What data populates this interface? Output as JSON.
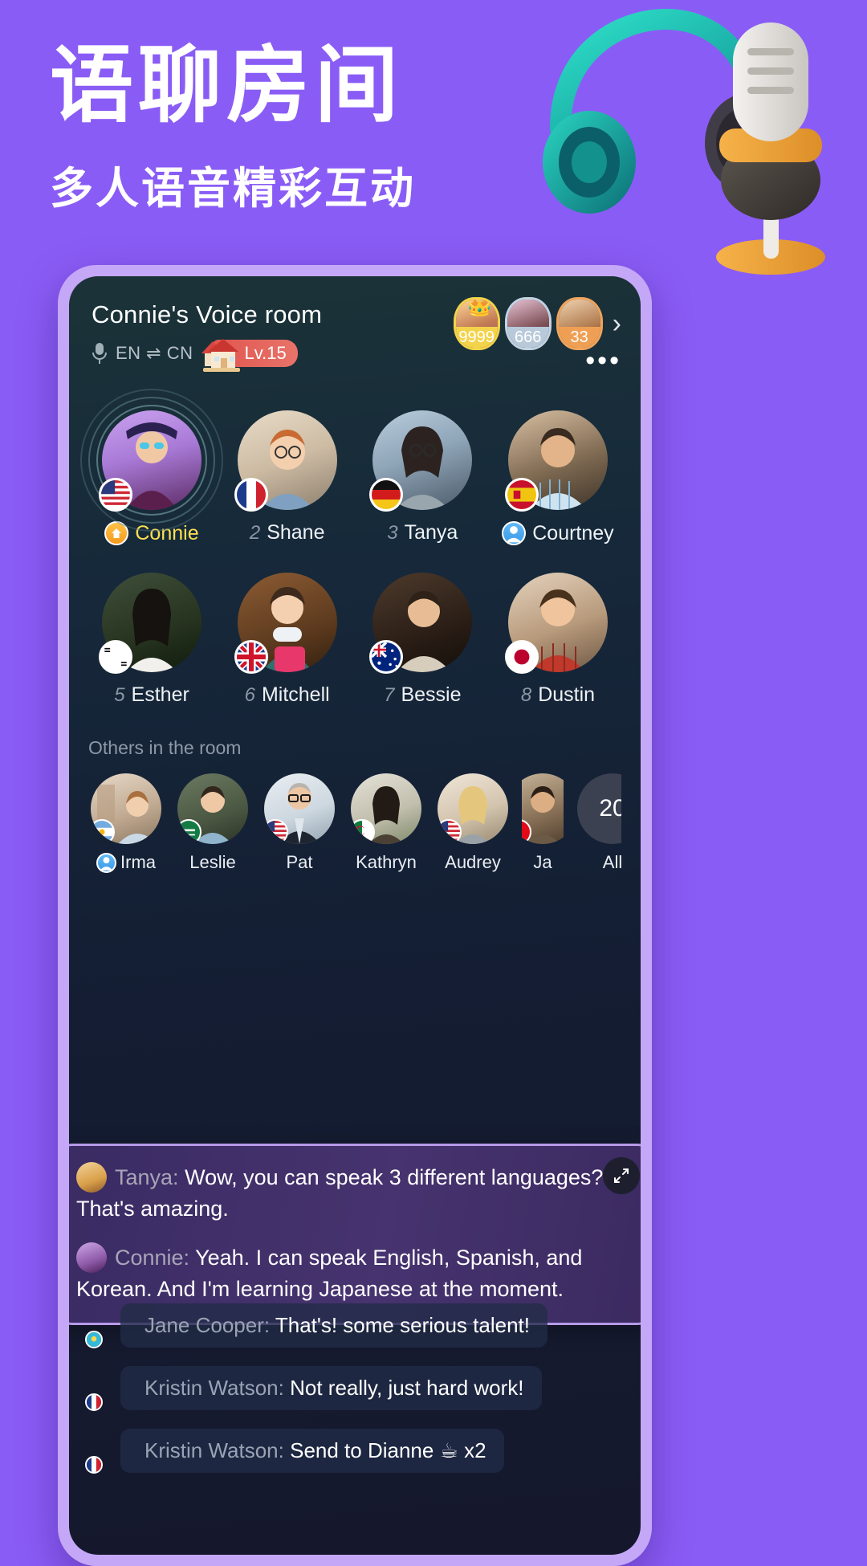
{
  "hero": {
    "title": "语聊房间",
    "subtitle": "多人语音精彩互动",
    "bg_color": "#8a5cf6",
    "art": [
      "headphones-illustration",
      "microphone-illustration"
    ]
  },
  "room": {
    "title": "Connie's Voice room",
    "mic_icon": "microphone-icon",
    "language": "EN ⇌ CN",
    "level_badge": {
      "label": "Lv.15",
      "icon": "house-icon"
    },
    "more_icon": "more-dots-icon",
    "chevron_icon": "chevron-right-icon",
    "rank_badges": [
      {
        "value": "9999",
        "accent": "#f3d34a",
        "crown": "crown-icon"
      },
      {
        "value": "666",
        "accent": "#b8c9da",
        "crown": ""
      },
      {
        "value": "33",
        "accent": "#ef9f54",
        "crown": ""
      }
    ]
  },
  "seats": {
    "row1": [
      {
        "num": "",
        "name": "Connie",
        "flag": "us-flag",
        "badge": "home-badge",
        "host": true,
        "speaking": true
      },
      {
        "num": "2",
        "name": "Shane",
        "flag": "fr-flag",
        "badge": "",
        "host": false,
        "speaking": false
      },
      {
        "num": "3",
        "name": "Tanya",
        "flag": "de-flag",
        "badge": "",
        "host": false,
        "speaking": false
      },
      {
        "num": "",
        "name": "Courtney",
        "flag": "es-flag",
        "badge": "user-badge",
        "host": false,
        "speaking": false
      }
    ],
    "row2": [
      {
        "num": "5",
        "name": "Esther",
        "flag": "kr-flag",
        "badge": "",
        "host": false,
        "speaking": false
      },
      {
        "num": "6",
        "name": "Mitchell",
        "flag": "gb-flag",
        "badge": "",
        "host": false,
        "speaking": false
      },
      {
        "num": "7",
        "name": "Bessie",
        "flag": "au-flag",
        "badge": "",
        "host": false,
        "speaking": false
      },
      {
        "num": "8",
        "name": "Dustin",
        "flag": "jp-flag",
        "badge": "",
        "host": false,
        "speaking": false
      }
    ]
  },
  "others": {
    "title": "Others in the room",
    "people": [
      {
        "name": "Irma",
        "flag": "ar-flag",
        "badge": "user-badge"
      },
      {
        "name": "Leslie",
        "flag": "sa-flag",
        "badge": ""
      },
      {
        "name": "Pat",
        "flag": "us-flag",
        "badge": ""
      },
      {
        "name": "Kathryn",
        "flag": "dz-flag",
        "badge": ""
      },
      {
        "name": "Audrey",
        "flag": "us-flag",
        "badge": ""
      },
      {
        "name": "Ja",
        "flag": "tr-flag",
        "badge": ""
      }
    ],
    "all_count": "20",
    "all_label": "All"
  },
  "highlight": {
    "expand_icon": "expand-icon",
    "messages": [
      {
        "speaker": "Tanya:",
        "text": "Wow, you can speak 3 different languages? That's amazing."
      },
      {
        "speaker": "Connie:",
        "text": "Yeah. I can speak English, Spanish, and Korean. And I'm learning Japanese at the moment."
      }
    ]
  },
  "chat": {
    "messages": [
      {
        "speaker": "Jane Cooper:",
        "text": "That's! some serious talent!",
        "flag": "kz-flag"
      },
      {
        "speaker": "Kristin Watson:",
        "text": "Not really, just hard work!",
        "flag": "fr-flag"
      },
      {
        "speaker": "Kristin Watson:",
        "text": "Send to Dianne ☕ x2",
        "flag": "fr-flag"
      }
    ]
  }
}
